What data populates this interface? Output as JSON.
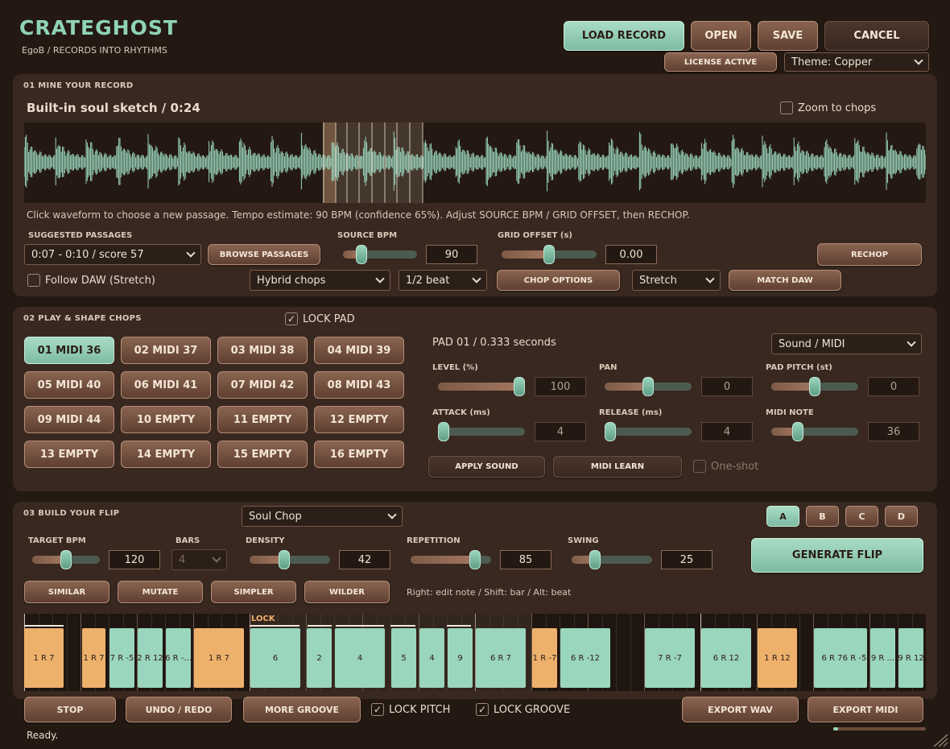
{
  "app": {
    "title": "CRATEGHOST",
    "subtitle": "EgoB  /  RECORDS INTO RHYTHMS"
  },
  "toolbar": {
    "load_record": "LOAD RECORD",
    "open": "OPEN",
    "save": "SAVE",
    "cancel": "CANCEL",
    "license": "LICENSE ACTIVE",
    "theme": "Theme: Copper"
  },
  "mine": {
    "section_title": "01  MINE YOUR RECORD",
    "record_title": "Built-in soul sketch  /  0:24",
    "zoom_label": "Zoom to chops",
    "hint": "Click waveform to choose a new passage. Tempo estimate: 90 BPM (confidence 65%). Adjust SOURCE BPM / GRID OFFSET, then RECHOP.",
    "suggested_label": "SUGGESTED PASSAGES",
    "suggested_value": "0:07 - 0:10  /  score 57",
    "browse": "BROWSE PASSAGES",
    "source_bpm_label": "SOURCE BPM",
    "source_bpm": "90",
    "source_bpm_level": 0.2,
    "grid_offset_label": "GRID OFFSET (s)",
    "grid_offset": "0.00",
    "grid_offset_level": 0.5,
    "rechop": "RECHOP",
    "follow_daw": "Follow DAW (Stretch)",
    "chop_mode": "Hybrid chops",
    "chop_size": "1/2 beat",
    "chop_options": "CHOP OPTIONS",
    "stretch": "Stretch",
    "match_daw": "MATCH DAW"
  },
  "pads": {
    "section_title": "02  PLAY & SHAPE CHOPS",
    "lock_pad": "LOCK PAD",
    "items": [
      "01  MIDI 36",
      "02  MIDI 37",
      "03  MIDI 38",
      "04  MIDI 39",
      "05  MIDI 40",
      "06  MIDI 41",
      "07  MIDI 42",
      "08  MIDI 43",
      "09  MIDI 44",
      "10  EMPTY",
      "11  EMPTY",
      "12  EMPTY",
      "13  EMPTY",
      "14  EMPTY",
      "15  EMPTY",
      "16  EMPTY"
    ],
    "active_index": 0,
    "pad_info": "PAD 01  /  0.333 seconds",
    "output_mode": "Sound / MIDI",
    "level_label": "LEVEL (%)",
    "level": "100",
    "level_level": 1.0,
    "pan_label": "PAN",
    "pan": "0",
    "pan_level": 0.5,
    "pitch_label": "PAD PITCH (st)",
    "pitch": "0",
    "pitch_level": 0.5,
    "attack_label": "ATTACK (ms)",
    "attack": "4",
    "attack_level": 0.0,
    "release_label": "RELEASE (ms)",
    "release": "4",
    "release_level": 0.0,
    "midi_note_label": "MIDI NOTE",
    "midi_note": "36",
    "midi_note_level": 0.28,
    "apply_sound": "APPLY SOUND",
    "midi_learn": "MIDI LEARN",
    "one_shot": "One-shot"
  },
  "flip": {
    "section_title": "03  BUILD YOUR FLIP",
    "style": "Soul Chop",
    "variations": [
      "A",
      "B",
      "C",
      "D"
    ],
    "active_variation": 0,
    "target_bpm_label": "TARGET BPM",
    "target_bpm": "120",
    "target_bpm_level": 0.5,
    "bars_label": "BARS",
    "bars": "4",
    "density_label": "DENSITY",
    "density": "42",
    "density_level": 0.42,
    "repetition_label": "REPETITION",
    "repetition": "85",
    "repetition_level": 0.85,
    "swing_label": "SWING",
    "swing": "25",
    "swing_level": 0.25,
    "generate": "GENERATE FLIP",
    "similar": "SIMILAR",
    "mutate": "MUTATE",
    "simpler": "SIMPLER",
    "wilder": "WILDER",
    "help": "Right: edit note  /  Shift: bar  /  Alt: beat",
    "lock_tag": "LOCK",
    "chips": [
      {
        "label": "1 R 7",
        "c": "o"
      },
      {
        "label": "1 R 7",
        "c": "o"
      },
      {
        "label": "7 R -5",
        "c": "t"
      },
      {
        "label": "2 R 12",
        "c": "t"
      },
      {
        "label": "6 R -...",
        "c": "t"
      },
      {
        "label": "1 R 7",
        "c": "o"
      },
      {
        "label": "6",
        "c": "t"
      },
      {
        "label": "2",
        "c": "t"
      },
      {
        "label": "4",
        "c": "t"
      },
      {
        "label": "5",
        "c": "t"
      },
      {
        "label": "4",
        "c": "t"
      },
      {
        "label": "9",
        "c": "t"
      },
      {
        "label": "6 R 7",
        "c": "t"
      },
      {
        "label": "1 R -7",
        "c": "o"
      },
      {
        "label": "6 R -12",
        "c": "t"
      },
      {
        "label": "7 R -7",
        "c": "t"
      },
      {
        "label": "6 R 12",
        "c": "t"
      },
      {
        "label": "1 R 12",
        "c": "o"
      },
      {
        "label": "6 R 7",
        "c": "t"
      },
      {
        "label": "6 R -5",
        "c": "t"
      },
      {
        "label": "9 R ...",
        "c": "t"
      },
      {
        "label": "9 R 12",
        "c": "t"
      }
    ]
  },
  "bottom": {
    "stop": "STOP",
    "undo_redo": "UNDO / REDO",
    "more_groove": "MORE GROOVE",
    "lock_pitch": "LOCK PITCH",
    "lock_groove": "LOCK GROOVE",
    "export_wav": "EXPORT WAV",
    "export_midi": "EXPORT MIDI",
    "status": "Ready.",
    "progress": 0.05
  }
}
